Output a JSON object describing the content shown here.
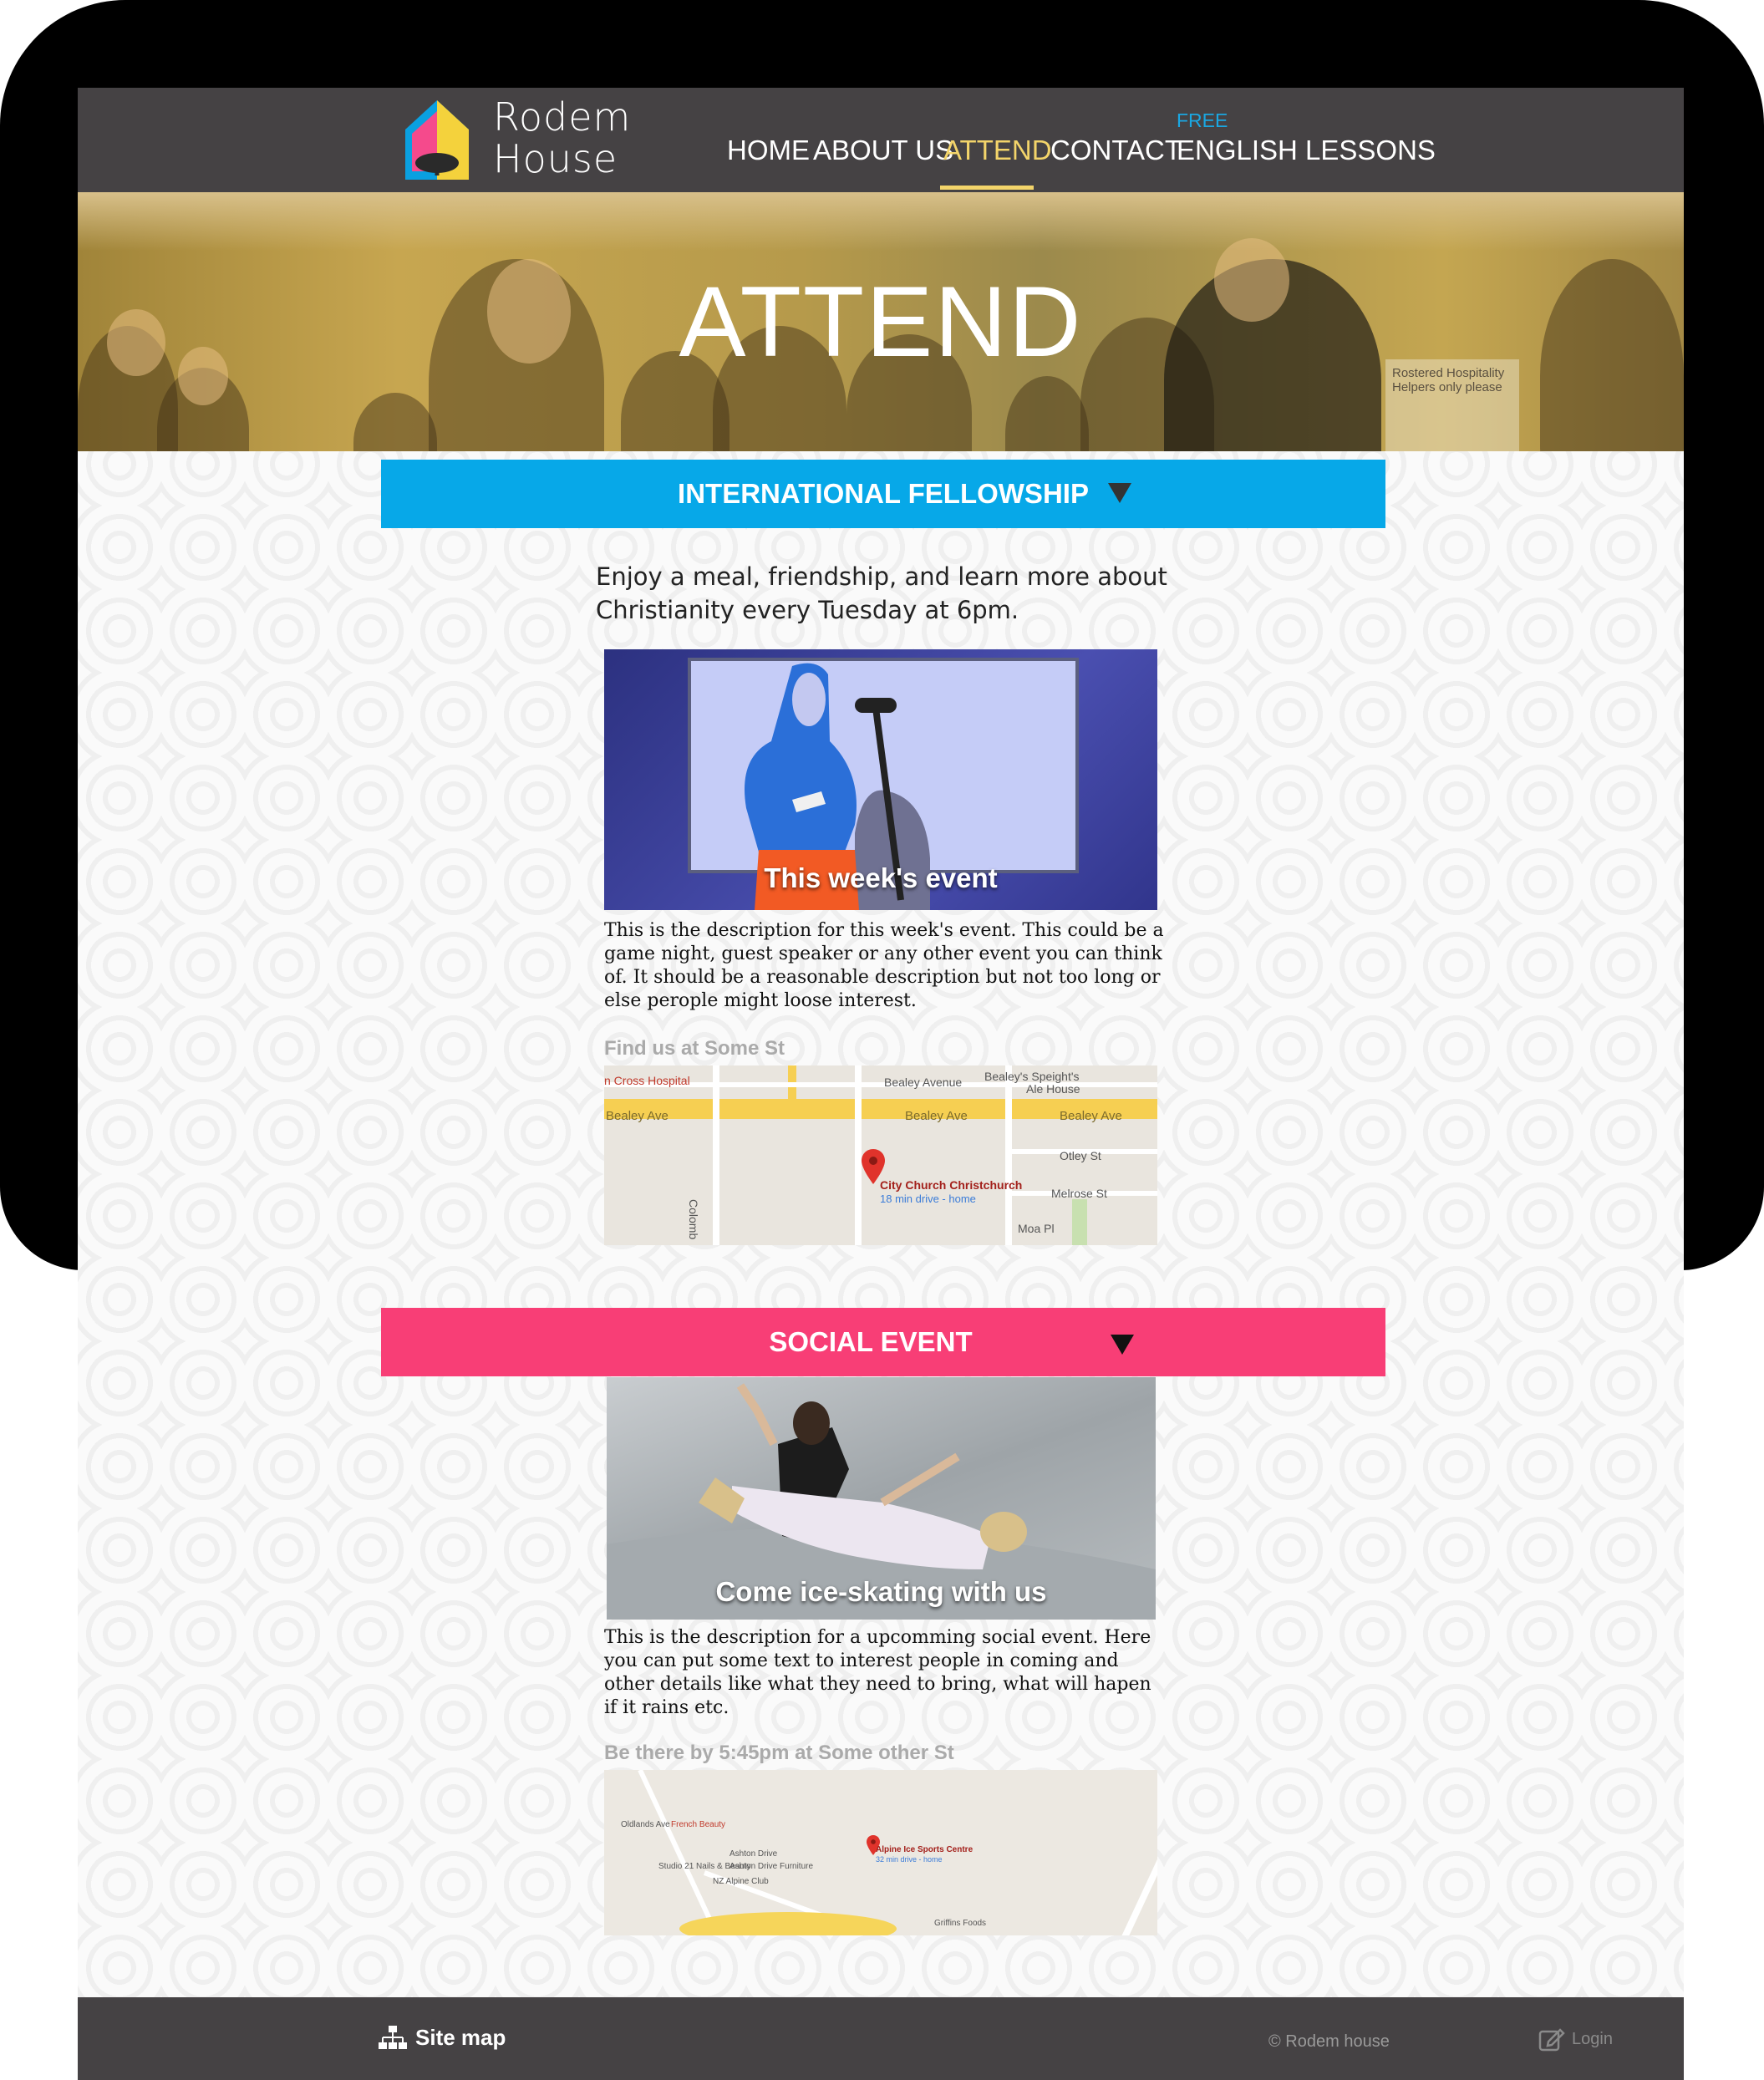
{
  "brand": {
    "name_line1": "Rodem",
    "name_line2": "House"
  },
  "nav": {
    "home": "HOME",
    "about": "ABOUT US",
    "attend": "ATTEND",
    "contact": "CONTACT",
    "free_badge": "FREE",
    "english": "ENGLISH LESSONS"
  },
  "hero": {
    "title": "ATTEND",
    "sign_line1": "Rostered Hospitality",
    "sign_line2": "Helpers only please"
  },
  "fellowship": {
    "header": "INTERNATIONAL FELLOWSHIP",
    "intro": "Enjoy a meal, friendship, and learn more about Christianity every Tuesday at 6pm.",
    "event_caption": "This week's event",
    "event_description": "This is the description for this week's event. This could be a game night, guest speaker or any other event you can think of. It should be a reasonable description but not too long or else perople might loose interest.",
    "location_label": "Find us at Some St",
    "map": {
      "labels": {
        "hospital": "n Cross Hospital",
        "bealey_avenue": "Bealey Avenue",
        "speights": "Bealey's Speight's",
        "speights2": "Ale House",
        "bealey_ave_1": "Bealey Ave",
        "bealey_ave_2": "Bealey Ave",
        "bealey_ave_3": "Bealey Ave",
        "otley": "Otley St",
        "melrose": "Melrose St",
        "moa": "Moa Pl",
        "colombo": "Colomb",
        "church": "City Church Christchurch",
        "drive": "18 min drive - home"
      }
    }
  },
  "social": {
    "header": "SOCIAL EVENT",
    "event_caption": "Come ice-skating with us",
    "event_description": "This is the description for a upcomming social event. Here you can put some text to interest people in coming and other details like what they need to bring, what will hapen if it rains etc.",
    "location_label": "Be there by 5:45pm at Some other St",
    "map": {
      "labels": {
        "venue": "Alpine Ice Sports Centre",
        "venue_sub": "32 min drive - home",
        "ashton": "Ashton Drive",
        "ashton_furn": "Ashton Drive Furniture",
        "studio": "Studio 21 Nails & Beauty",
        "alpine_club": "NZ Alpine Club",
        "french": "French Beauty",
        "oldlands": "Oldlands Ave",
        "griffins": "Griffins Foods"
      }
    }
  },
  "footer": {
    "sitemap": "Site map",
    "copyright": "© Rodem house",
    "login": "Login"
  },
  "colors": {
    "fellowship": "#07a8e8",
    "social": "#f83e76",
    "navbar": "#454244",
    "active": "#f3d46a"
  }
}
